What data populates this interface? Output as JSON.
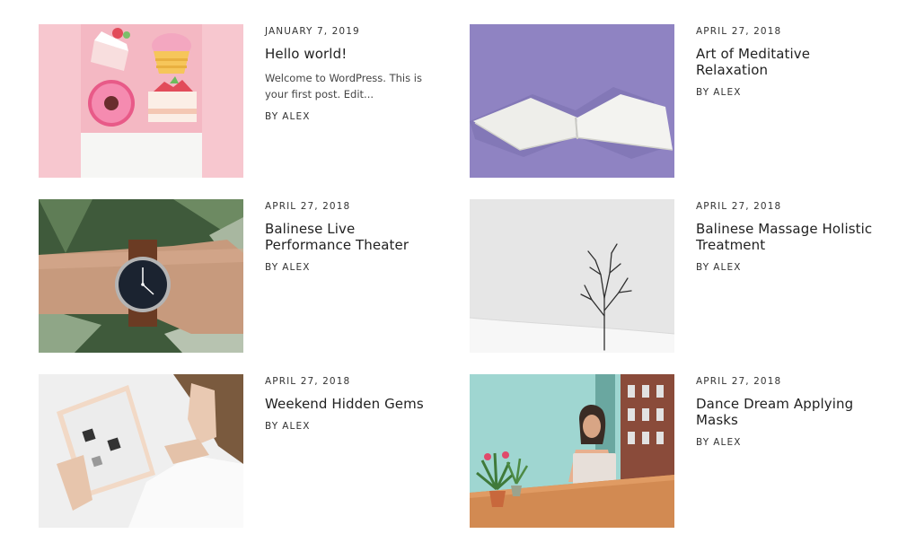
{
  "posts": [
    {
      "date": "JANUARY 7, 2019",
      "title": "Hello world!",
      "excerpt": "Welcome to WordPress. This is your first post. Edit...",
      "by": "BY",
      "author": "ALEX"
    },
    {
      "date": "APRIL 27, 2018",
      "title": "Art of Meditative Relaxation",
      "by": "BY",
      "author": "ALEX"
    },
    {
      "date": "APRIL 27, 2018",
      "title": "Balinese Live Performance Theater",
      "by": "BY",
      "author": "ALEX"
    },
    {
      "date": "APRIL 27, 2018",
      "title": "Balinese Massage Holistic Treatment",
      "by": "BY",
      "author": "ALEX"
    },
    {
      "date": "APRIL 27, 2018",
      "title": "Weekend Hidden Gems",
      "by": "BY",
      "author": "ALEX"
    },
    {
      "date": "APRIL 27, 2018",
      "title": "Dance Dream Applying Masks",
      "by": "BY",
      "author": "ALEX"
    }
  ],
  "images": [
    {
      "subject": "pastel-desserts"
    },
    {
      "subject": "open-book-on-lavender"
    },
    {
      "subject": "wristwatch-on-leaves"
    },
    {
      "subject": "lone-tree-in-snow"
    },
    {
      "subject": "woman-using-tablet"
    },
    {
      "subject": "woman-with-laptop"
    }
  ],
  "colors": {
    "text": "#2b2b2b",
    "background": "#ffffff"
  }
}
